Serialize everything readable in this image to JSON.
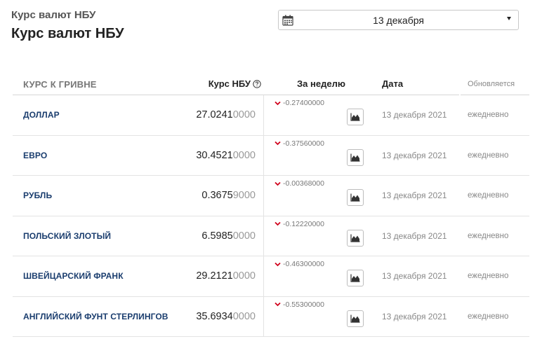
{
  "header": {
    "subtitle": "Курс валют НБУ",
    "title": "Курс валют НБУ"
  },
  "date_picker": {
    "value": "13 декабря",
    "icon": "calendar-icon"
  },
  "table": {
    "columns": {
      "name": "КУРС К ГРИВНЕ",
      "rate": "Курс НБУ",
      "week": "За неделю",
      "date": "Дата",
      "updated": "Обновляется"
    },
    "rows": [
      {
        "name": "ДОЛЛАР",
        "rate_main": "27.0241",
        "rate_tail": "0000",
        "change": "-0.27400000",
        "date": "13 декабря 2021",
        "updated": "ежедневно"
      },
      {
        "name": "ЕВРО",
        "rate_main": "30.4521",
        "rate_tail": "0000",
        "change": "-0.37560000",
        "date": "13 декабря 2021",
        "updated": "ежедневно"
      },
      {
        "name": "РУБЛЬ",
        "rate_main": "0.3675",
        "rate_tail": "9000",
        "change": "-0.00368000",
        "date": "13 декабря 2021",
        "updated": "ежедневно"
      },
      {
        "name": "ПОЛЬСКИЙ ЗЛОТЫЙ",
        "rate_main": "6.5985",
        "rate_tail": "0000",
        "change": "-0.12220000",
        "date": "13 декабря 2021",
        "updated": "ежедневно"
      },
      {
        "name": "ШВЕЙЦАРСКИЙ ФРАНК",
        "rate_main": "29.2121",
        "rate_tail": "0000",
        "change": "-0.46300000",
        "date": "13 декабря 2021",
        "updated": "ежедневно"
      },
      {
        "name": "АНГЛИЙСКИЙ ФУНТ СТЕРЛИНГОВ",
        "rate_main": "35.6934",
        "rate_tail": "0000",
        "change": "-0.55300000",
        "date": "13 декабря 2021",
        "updated": "ежедневно"
      }
    ]
  },
  "colors": {
    "currency_name": "#1a3d6e",
    "down_arrow": "#d0021b"
  }
}
